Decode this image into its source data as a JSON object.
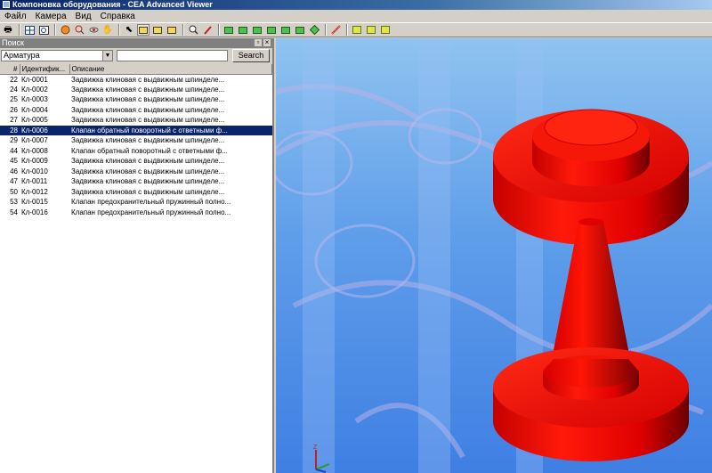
{
  "window": {
    "title": "Компоновка оборудования - CEA Advanced Viewer"
  },
  "menu": [
    "Файл",
    "Камера",
    "Вид",
    "Справка"
  ],
  "search_panel": {
    "title": "Поиск",
    "category": "Арматура",
    "query": "",
    "button": "Search",
    "columns": [
      "#",
      "Идентифик...",
      "Описание"
    ],
    "rows": [
      {
        "num": "22",
        "id": "Кл-0001",
        "desc": "Задвижка клиновая с выдвижным шпинделе..."
      },
      {
        "num": "24",
        "id": "Кл-0002",
        "desc": "Задвижка клиновая с выдвижным шпинделе..."
      },
      {
        "num": "25",
        "id": "Кл-0003",
        "desc": "Задвижка клиновая с выдвижным шпинделе..."
      },
      {
        "num": "26",
        "id": "Кл-0004",
        "desc": "Задвижка клиновая с выдвижным шпинделе..."
      },
      {
        "num": "27",
        "id": "Кл-0005",
        "desc": "Задвижка клиновая с выдвижным шпинделе..."
      },
      {
        "num": "28",
        "id": "Кл-0006",
        "desc": "Клапан обратный поворотный с ответными ф..."
      },
      {
        "num": "29",
        "id": "Кл-0007",
        "desc": "Задвижка клиновая с выдвижным шпинделе..."
      },
      {
        "num": "44",
        "id": "Кл-0008",
        "desc": "Клапан обратный поворотный с ответными ф..."
      },
      {
        "num": "45",
        "id": "Кл-0009",
        "desc": "Задвижка клиновая с выдвижным шпинделе..."
      },
      {
        "num": "46",
        "id": "Кл-0010",
        "desc": "Задвижка клиновая с выдвижным шпинделе..."
      },
      {
        "num": "47",
        "id": "Кл-0011",
        "desc": "Задвижка клиновая с выдвижным шпинделе..."
      },
      {
        "num": "50",
        "id": "Кл-0012",
        "desc": "Задвижка клиновая с выдвижным шпинделе..."
      },
      {
        "num": "53",
        "id": "Кл-0015",
        "desc": "Клапан предохранительный пружинный полно..."
      },
      {
        "num": "54",
        "id": "Кл-0016",
        "desc": "Клапан предохранительный пружинный полно..."
      }
    ],
    "selected_index": 5
  },
  "viewport": {
    "axis_label": "Z"
  }
}
